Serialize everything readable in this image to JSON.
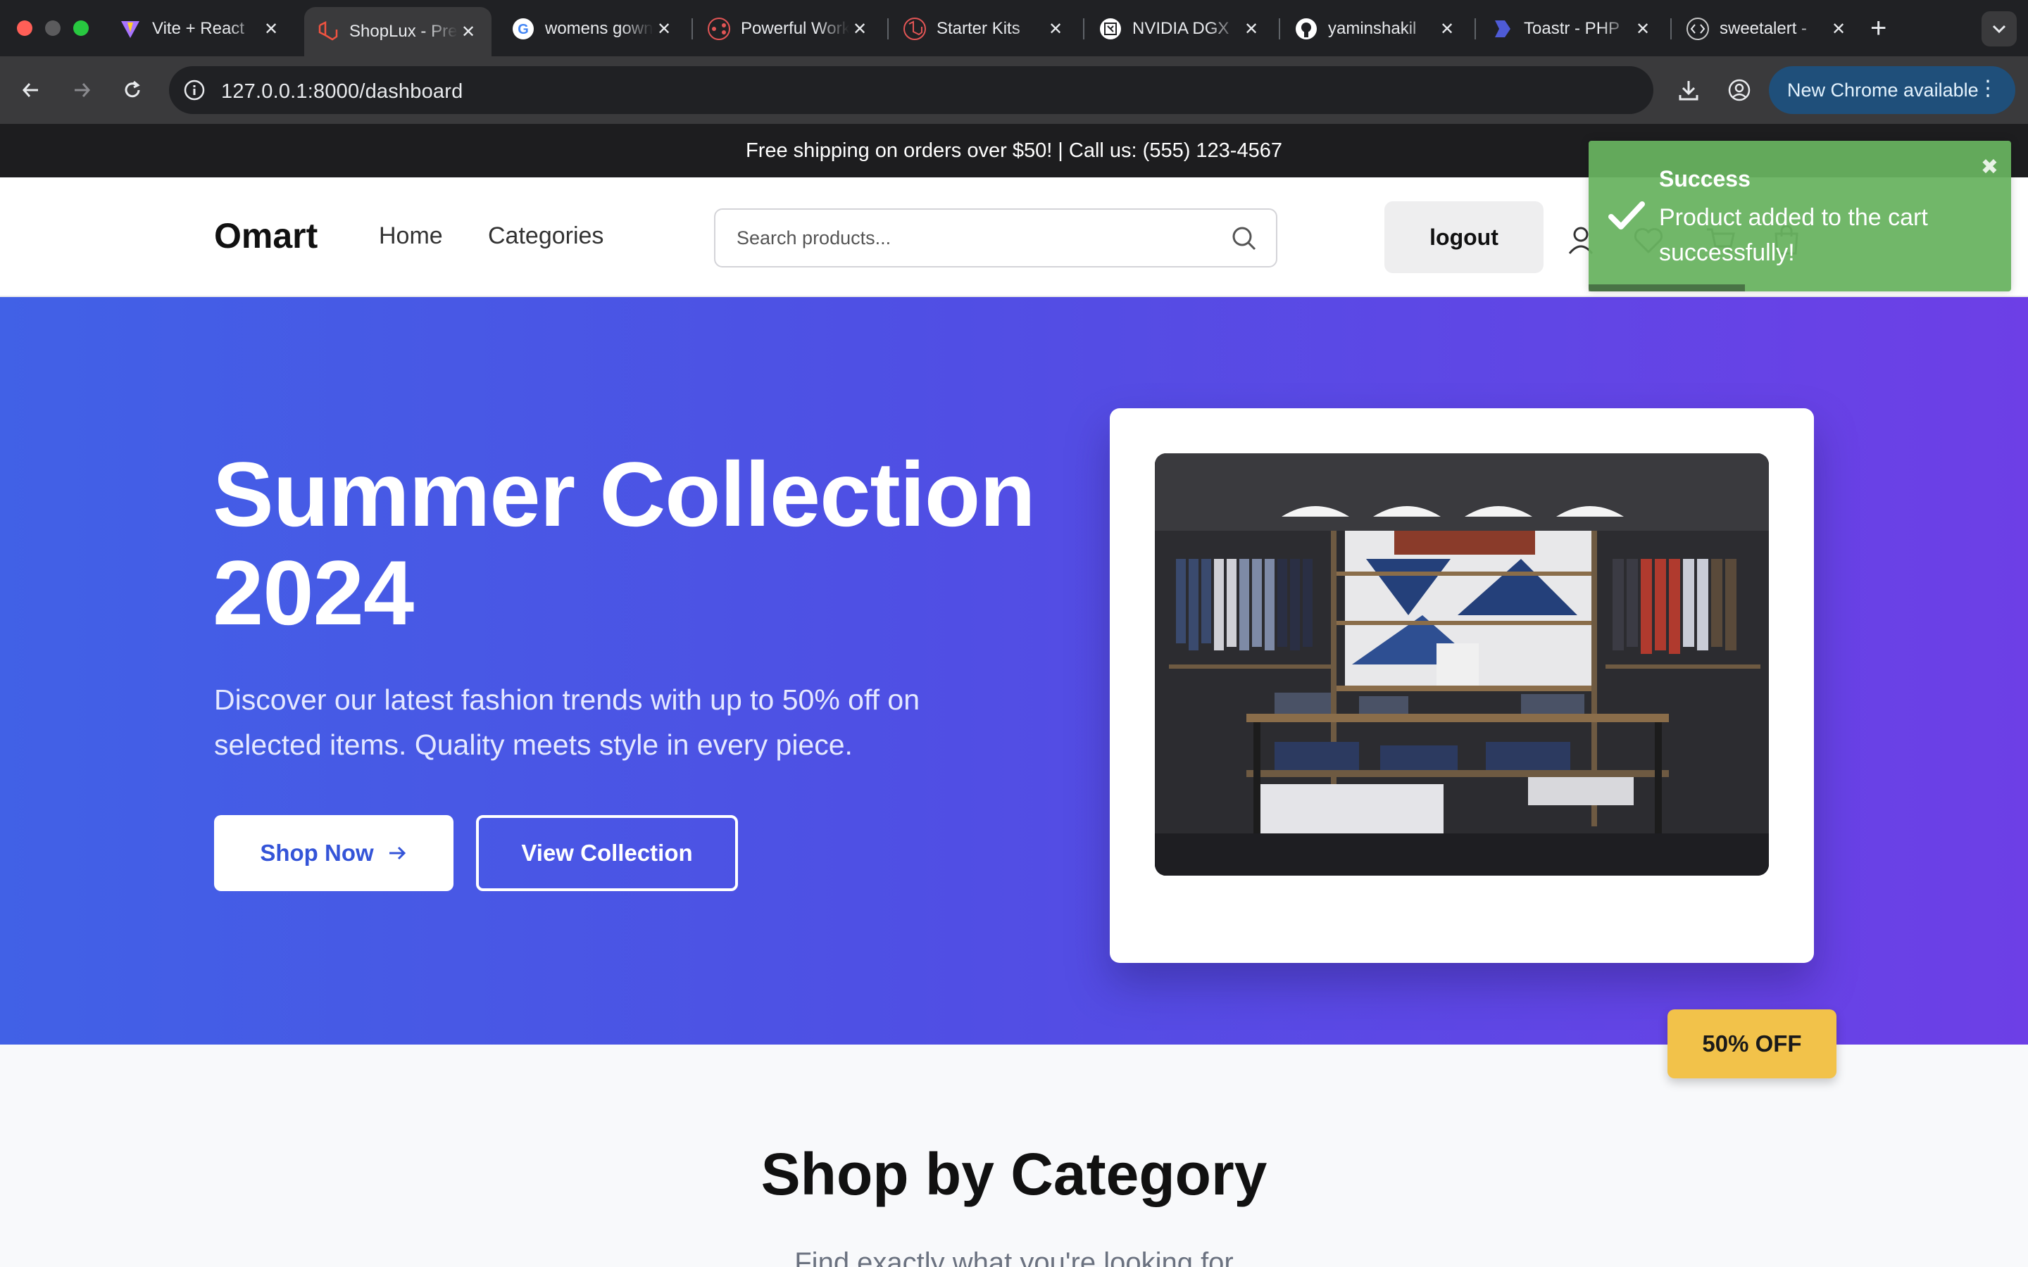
{
  "browser": {
    "tabs": [
      {
        "title": "Vite + React",
        "icon": "vite-icon"
      },
      {
        "title": "ShopLux - Premium",
        "icon": "laravel-icon",
        "active": true
      },
      {
        "title": "womens gowns",
        "icon": "google-icon"
      },
      {
        "title": "Powerful Workflow",
        "icon": "workflow-icon"
      },
      {
        "title": "Starter Kits",
        "icon": "laravel-icon"
      },
      {
        "title": "NVIDIA DGX",
        "icon": "nvidia-icon"
      },
      {
        "title": "yaminshakil",
        "icon": "github-icon"
      },
      {
        "title": "Toastr - PHP",
        "icon": "php-icon"
      },
      {
        "title": "sweetalert - ",
        "icon": "code-icon"
      }
    ],
    "close_glyph": "✕",
    "new_tab_glyph": "+",
    "url": "127.0.0.1:8000/dashboard",
    "update_label": "New Chrome available",
    "update_menu_glyph": "⋮"
  },
  "site": {
    "announcement": "Free shipping on orders over $50! | Call us: (555) 123-4567",
    "brand": "Omart",
    "nav": [
      {
        "label": "Home"
      },
      {
        "label": "Categories"
      }
    ],
    "search_placeholder": "Search products...",
    "logout_label": "logout"
  },
  "hero": {
    "title_line1": "Summer Collection",
    "title_line2": "2024",
    "text_line1": "Discover our latest fashion trends with up to 50% off on",
    "text_line2": "selected items. Quality meets style in every piece.",
    "shop_now_label": "Shop Now",
    "view_collection_label": "View Collection",
    "badge": "50% OFF"
  },
  "categories": {
    "title": "Shop by Category",
    "subtitle": "Find exactly what you're looking for"
  },
  "toast": {
    "title": "Success",
    "message": "Product added to the cart successfully!",
    "close_glyph": "✖",
    "progress": 0.37
  },
  "colors": {
    "hero_start": "#4161e6",
    "hero_end": "#6d3fe6",
    "toast_bg": "#68b260",
    "badge_bg": "#f2c24a"
  }
}
